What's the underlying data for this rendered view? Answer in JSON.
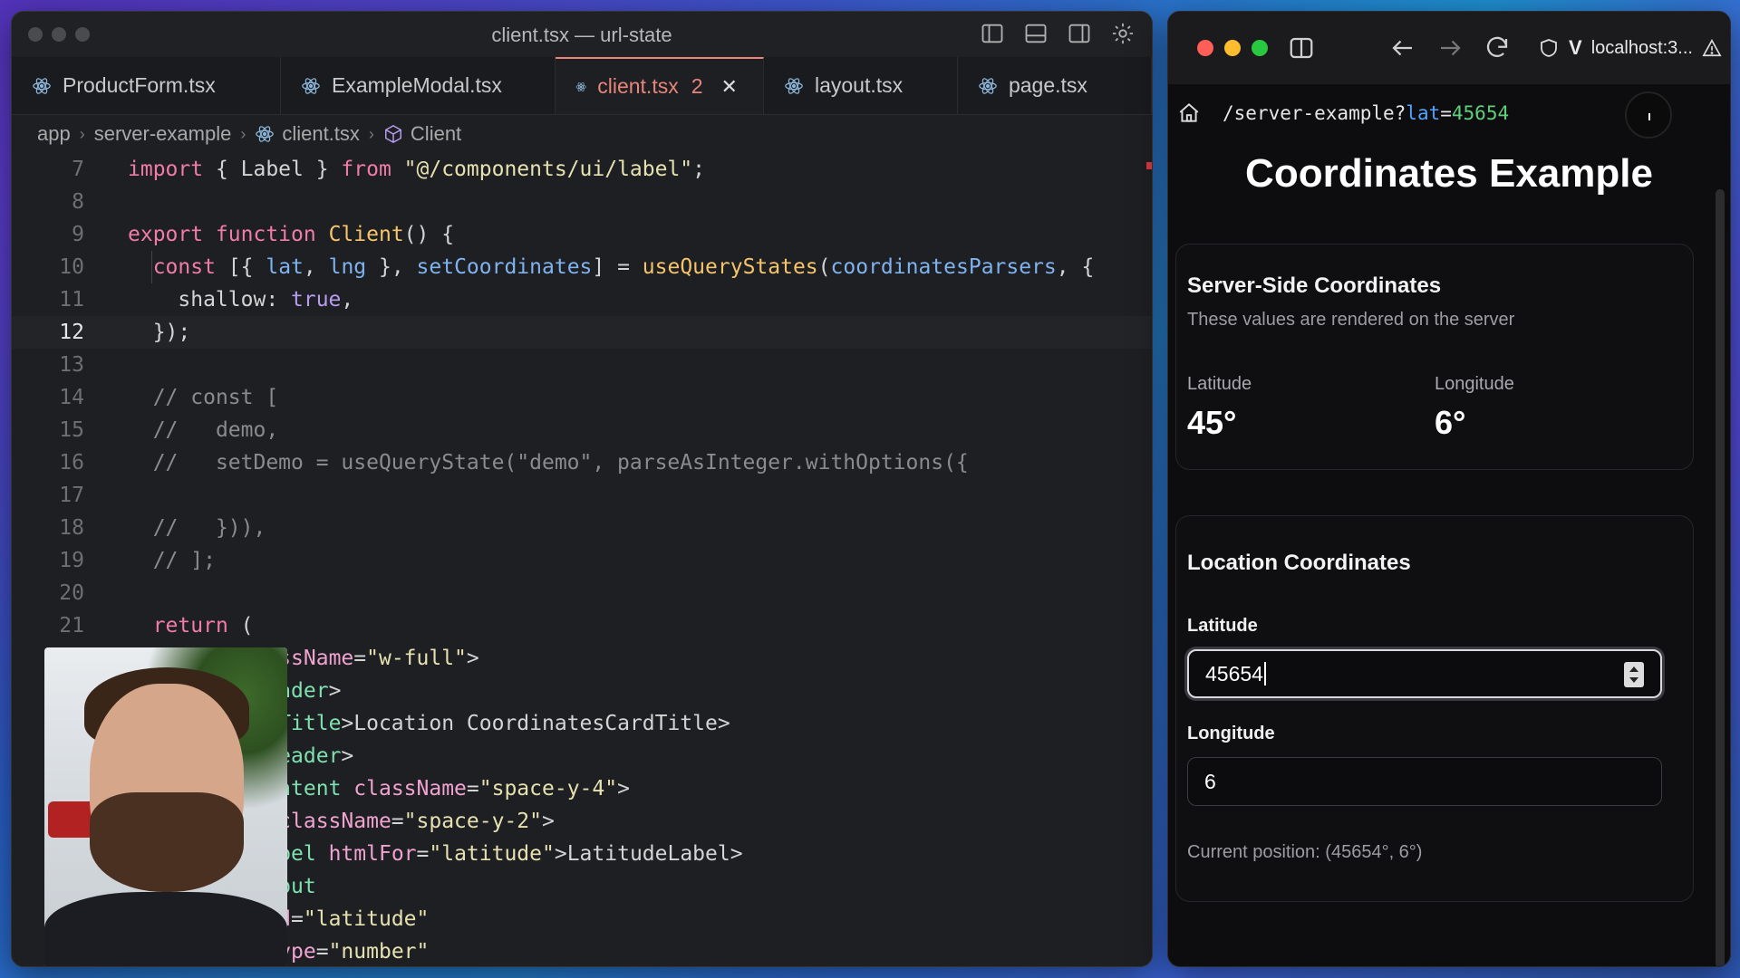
{
  "editor": {
    "title": "client.tsx — url-state",
    "tabs": [
      {
        "label": "ProductForm.tsx",
        "badge": "",
        "active": false
      },
      {
        "label": "ExampleModal.tsx",
        "badge": "",
        "active": false
      },
      {
        "label": "client.tsx",
        "badge": "2",
        "active": true
      },
      {
        "label": "layout.tsx",
        "badge": "",
        "active": false
      },
      {
        "label": "page.tsx",
        "badge": "",
        "active": false
      }
    ],
    "breadcrumb": [
      "app",
      "server-example",
      "client.tsx",
      "Client"
    ],
    "lines": [
      {
        "n": "7",
        "html": "<span class=\"kw\">import</span> { Label } <span class=\"kw\">from</span> <span class=\"str\">\"@/components/ui/label\"</span>;"
      },
      {
        "n": "8",
        "html": ""
      },
      {
        "n": "9",
        "html": "<span class=\"kw\">export function</span> <span class=\"fn\">Client</span>() {"
      },
      {
        "n": "10",
        "html": "  <span class=\"kw\">const</span> [{ <span class=\"var\">lat</span>, <span class=\"var\">lng</span> }, <span class=\"var\">setCoordinates</span>] = <span class=\"fn\">useQueryStates</span>(<span class=\"var\">coordinatesParsers</span>, {"
      },
      {
        "n": "11",
        "html": "    shallow: <span class=\"bool\">true</span>,"
      },
      {
        "n": "12",
        "html": "  });",
        "current": true
      },
      {
        "n": "13",
        "html": ""
      },
      {
        "n": "14",
        "html": "  <span class=\"com\">// const [</span>"
      },
      {
        "n": "15",
        "html": "  <span class=\"com\">//   demo,</span>"
      },
      {
        "n": "16",
        "html": "  <span class=\"com\">//   setDemo = useQueryState(\"demo\", parseAsInteger.withOptions({</span>"
      },
      {
        "n": "17",
        "html": ""
      },
      {
        "n": "18",
        "html": "  <span class=\"com\">//   })),</span>"
      },
      {
        "n": "19",
        "html": "  <span class=\"com\">// ];</span>"
      },
      {
        "n": "20",
        "html": ""
      },
      {
        "n": "21",
        "html": "  <span class=\"kw\">return</span> ("
      },
      {
        "n": "",
        "html": "           <span class=\"attr\">assName</span>=<span class=\"str\">\"w-full\"</span>>"
      },
      {
        "n": "",
        "html": "           <span class=\"tag\">eader</span>>"
      },
      {
        "n": "",
        "html": "           <span class=\"tag\">dTitle</span>>Location Coordinates</<span class=\"tag\">CardTitle</span>>"
      },
      {
        "n": "",
        "html": "           <span class=\"tag\">Header</span>>"
      },
      {
        "n": "",
        "html": "           <span class=\"tag\">ontent</span> <span class=\"attr\">className</span>=<span class=\"str\">\"space-y-4\"</span>>"
      },
      {
        "n": "",
        "html": "            <span class=\"attr\">className</span>=<span class=\"str\">\"space-y-2\"</span>>"
      },
      {
        "n": "",
        "html": "           <span class=\"tag\">abel</span> <span class=\"attr\">htmlFor</span>=<span class=\"str\">\"latitude\"</span>>Latitude</<span class=\"tag\">Label</span>>"
      },
      {
        "n": "",
        "html": "           <span class=\"tag\">nput</span>"
      },
      {
        "n": "",
        "html": "           <span class=\"attr\">id</span>=<span class=\"str\">\"latitude\"</span>"
      },
      {
        "n": "",
        "html": "           <span class=\"attr\">type</span>=<span class=\"str\">\"number\"</span>"
      }
    ]
  },
  "browser": {
    "host": "localhost:3...",
    "path": "/server-example?",
    "query_key": "lat",
    "query_eq": "=",
    "query_value": "45654",
    "page_title": "Coordinates Example",
    "server_card": {
      "title": "Server-Side Coordinates",
      "description": "These values are rendered on the server",
      "lat_label": "Latitude",
      "lat_value": "45°",
      "lng_label": "Longitude",
      "lng_value": "6°"
    },
    "location_card": {
      "title": "Location Coordinates",
      "lat_label": "Latitude",
      "lat_value": "45654",
      "lng_label": "Longitude",
      "lng_value": "6",
      "current_position": "Current position: (45654°, 6°)"
    }
  },
  "colors": {
    "traffic_red": "#ff5f57",
    "traffic_yellow": "#febc2e",
    "traffic_green": "#28c840",
    "tab_active": "#e8857a",
    "query_key": "#4fa3ff",
    "query_value": "#5fd07a"
  }
}
